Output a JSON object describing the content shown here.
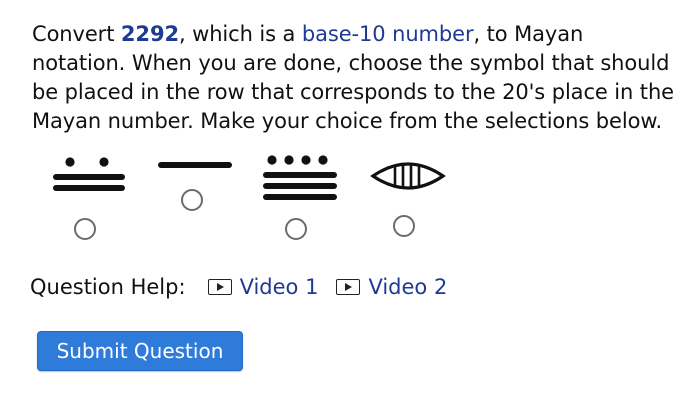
{
  "question": {
    "convert_prefix": "Convert ",
    "number": "2292",
    "comma_which_is": ", which is a ",
    "base_link": "base-10 number",
    "to_mayan": ", to Mayan notation.",
    "line2": "When you are done, choose the symbol that should be placed in the row that corresponds to the 20's place in the Mayan number. Make your choice from the selections below."
  },
  "choices": [
    {
      "symbol": "two-dots-two-bars",
      "dots": 2,
      "bars": 2,
      "selected": false
    },
    {
      "symbol": "one-bar",
      "dots": 0,
      "bars": 1,
      "selected": false
    },
    {
      "symbol": "four-dots-three-bars",
      "dots": 4,
      "bars": 3,
      "selected": false
    },
    {
      "symbol": "shell-zero",
      "dots": 0,
      "bars": 0,
      "selected": false
    }
  ],
  "help": {
    "label": "Question Help:",
    "video1": "Video 1",
    "video2": "Video 2"
  },
  "submit_label": "Submit Question",
  "colors": {
    "link": "#1f3a93",
    "button": "#2f7bd9",
    "radio_border": "#6b6b6b"
  }
}
